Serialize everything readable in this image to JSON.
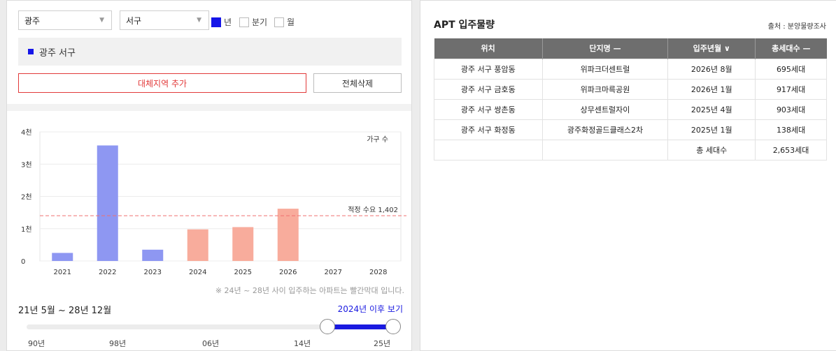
{
  "filters": {
    "city": "광주",
    "district": "서구",
    "periods": [
      {
        "label": "년",
        "checked": true
      },
      {
        "label": "분기",
        "checked": false
      },
      {
        "label": "월",
        "checked": false
      }
    ]
  },
  "region_tag": "광주 서구",
  "buttons": {
    "add": "대체지역 추가",
    "delete_all": "전체삭제"
  },
  "chart_data": {
    "type": "bar",
    "categories": [
      "2021",
      "2022",
      "2023",
      "2024",
      "2025",
      "2026",
      "2027",
      "2028"
    ],
    "values": [
      250,
      3580,
      350,
      980,
      1050,
      1620,
      0,
      0
    ],
    "highlight": [
      false,
      false,
      false,
      true,
      true,
      true,
      true,
      true
    ],
    "colors": {
      "past": "#8e97f2",
      "future": "#f8ac9c",
      "ref_line": "#f07070"
    },
    "y_ticks": [
      "0",
      "1천",
      "2천",
      "3천",
      "4천"
    ],
    "ylim": [
      0,
      4000
    ],
    "legend": "가구 수",
    "ref_line": {
      "value": 1402,
      "label": "적정 수요 1,402"
    },
    "grid": true
  },
  "note": "※ 24년 ~ 28년 사이 입주하는 아파트는 빨간막대 입니다.",
  "period_range": "21년 5월 ~ 28년 12월",
  "after_link": "2024년 이후 보기",
  "slider": {
    "labels": [
      "90년",
      "98년",
      "06년",
      "14년",
      "25년"
    ],
    "range": [
      0.82,
      1.0
    ]
  },
  "supply": {
    "title": "APT 입주물량",
    "source": "출처 : 분양물량조사",
    "headers": [
      "위치",
      "단지명 —",
      "입주년월 ∨",
      "총세대수 —"
    ],
    "rows": [
      [
        "광주 서구 풍암동",
        "위파크더센트럴",
        "2026년 8월",
        "695세대"
      ],
      [
        "광주 서구 금호동",
        "위파크마륵공원",
        "2026년 1월",
        "917세대"
      ],
      [
        "광주 서구 쌍촌동",
        "상무센트럴자이",
        "2025년 4월",
        "903세대"
      ],
      [
        "광주 서구 화정동",
        "광주화정골드클래스2차",
        "2025년 1월",
        "138세대"
      ]
    ],
    "total_label": "총 세대수",
    "total_value": "2,653세대"
  }
}
